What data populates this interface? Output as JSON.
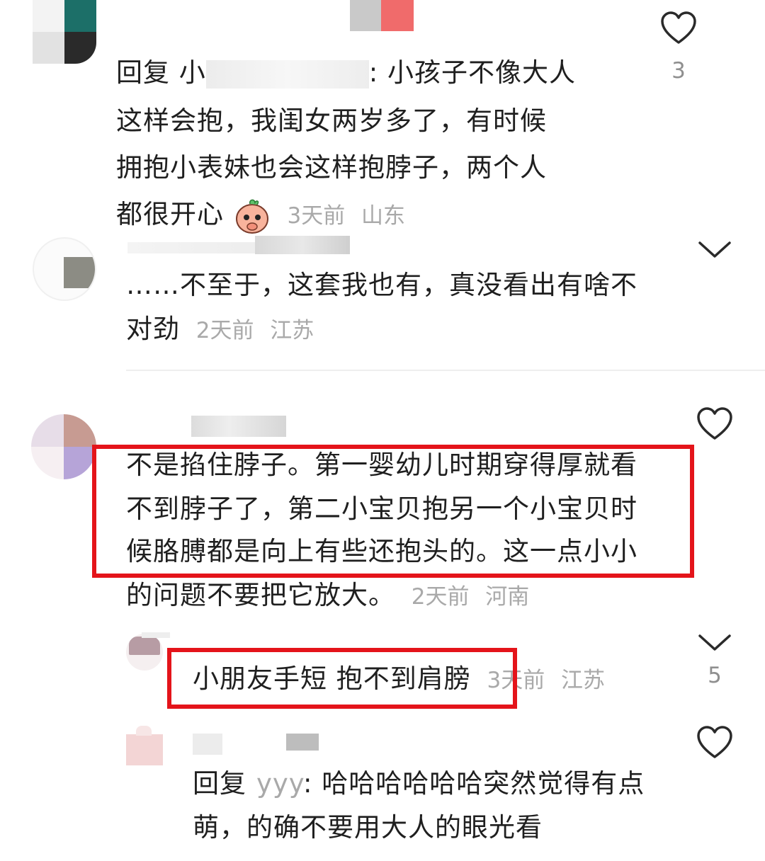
{
  "comments": [
    {
      "lines": [
        "回复 小",
        ": 小孩子不像大人",
        "这样会抱，我闺女两岁多了，有时候",
        "拥抱小表妹也会这样抱脖子，两个人",
        "都很开心"
      ],
      "time": "3天前",
      "location": "山东",
      "likes": "3"
    },
    {
      "lines": [
        "……不至于，这套我也有，真没看出有啥不",
        "对劲"
      ],
      "time": "2天前",
      "location": "江苏"
    },
    {
      "lines": [
        "不是掐住脖子。第一婴幼儿时期穿得厚就看",
        "不到脖子了，第二小宝贝抱另一个小宝贝时",
        "候胳膊都是向上有些还抱头的。这一点小小",
        "的问题不要把它放大。"
      ],
      "time": "2天前",
      "location": "河南"
    },
    {
      "lines": [
        "小朋友手短 抱不到肩膀"
      ],
      "time": "3天前",
      "location": "江苏",
      "likes": "5"
    },
    {
      "reply_prefix": "回复",
      "reply_user": "yyy",
      "lines": [
        ": 哈哈哈哈哈哈突然觉得有点",
        "萌，的确不要用大人的眼光看"
      ]
    }
  ],
  "colors": {
    "highlight": "#e4141a",
    "meta": "#a9a9a9"
  }
}
